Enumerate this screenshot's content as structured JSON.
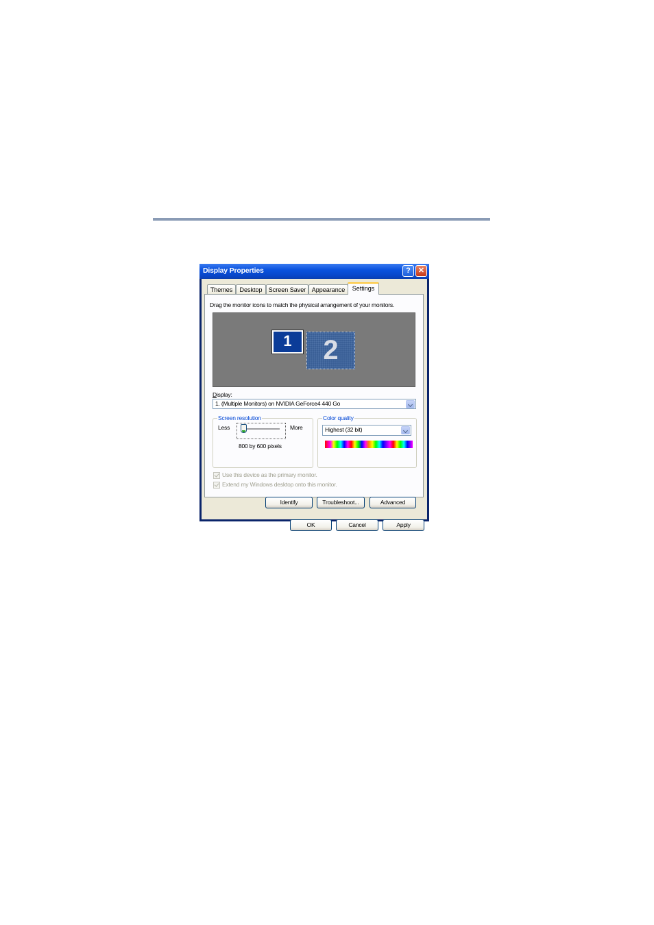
{
  "window": {
    "title": "Display Properties",
    "help_glyph": "?",
    "close_glyph": "✕"
  },
  "tabs": [
    "Themes",
    "Desktop",
    "Screen Saver",
    "Appearance",
    "Settings"
  ],
  "active_tab": "Settings",
  "settings": {
    "instruction": "Drag the monitor icons to match the physical arrangement of your monitors.",
    "monitors": [
      "1",
      "2"
    ],
    "display_label_prefix": "D",
    "display_label_rest": "isplay:",
    "display_value": "1. (Multiple Monitors) on NVIDIA GeForce4 440 Go",
    "resolution": {
      "group_label": "Screen resolution",
      "less": "Less",
      "more": "More",
      "value_text": "800 by 600 pixels",
      "slider_level": 0
    },
    "color_quality": {
      "group_label": "Color quality",
      "value": "Highest (32 bit)"
    },
    "primary_monitor_checkbox": "Use this device as the primary monitor.",
    "extend_desktop_checkbox": "Extend my Windows desktop onto this monitor.",
    "buttons": {
      "identify": "Identify",
      "troubleshoot": "Troubleshoot...",
      "advanced": "Advanced"
    }
  },
  "footer_buttons": {
    "ok": "OK",
    "cancel": "Cancel",
    "apply": "Apply"
  },
  "colors": {
    "title_bar": "#0a52de",
    "dialog_face": "#ece9d8",
    "page_rule": "#8a9bb5",
    "active_tab_highlight": "#ffc83c"
  }
}
